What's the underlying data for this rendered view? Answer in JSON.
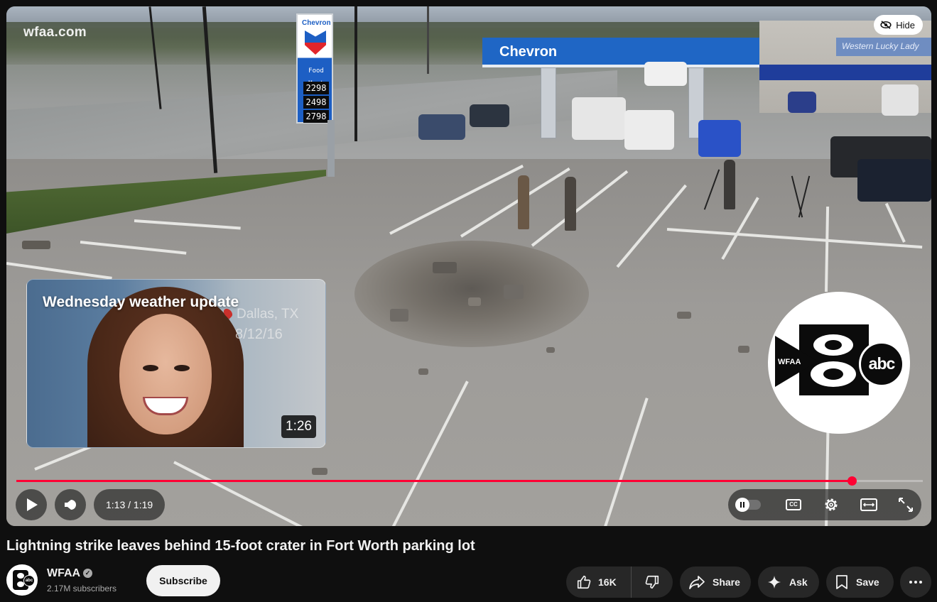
{
  "video": {
    "watermark": "wfaa.com",
    "hide_label": "Hide",
    "scene": {
      "canopy_text": "Chevron",
      "store_sign": "Western Lucky Lady",
      "pylon_brand": "Chevron",
      "pylon_sub": "Food Mart",
      "prices": [
        "2298",
        "2498",
        "2798"
      ]
    },
    "suggested": {
      "title": "Wednesday weather update",
      "location": "Dallas, TX",
      "date": "8/12/16",
      "duration": "1:26"
    },
    "logo": {
      "left_text": "WFAA",
      "right_text": "abc"
    },
    "progress": {
      "fraction": 0.922
    },
    "controls": {
      "time": "1:13 / 1:19",
      "cc_label": "CC"
    }
  },
  "meta": {
    "title": "Lightning strike leaves behind 15-foot crater in Fort Worth parking lot",
    "channel": "WFAA",
    "subscribers": "2.17M subscribers",
    "subscribe_label": "Subscribe",
    "likes": "16K",
    "share_label": "Share",
    "ask_label": "Ask",
    "save_label": "Save",
    "avatar_abc": "abc"
  },
  "icons": {
    "play": "play-icon",
    "volume": "volume-icon",
    "settings": "gear-icon",
    "theater": "theater-icon",
    "fullscreen": "fullscreen-icon",
    "like": "thumb-up-icon",
    "dislike": "thumb-down-icon",
    "share": "share-arrow-icon",
    "ask": "sparkle-icon",
    "save": "bookmark-icon",
    "more": "more-dots-icon"
  },
  "colors": {
    "progress": "#ff0033",
    "background": "#0f0f0f",
    "pill": "#272727"
  }
}
